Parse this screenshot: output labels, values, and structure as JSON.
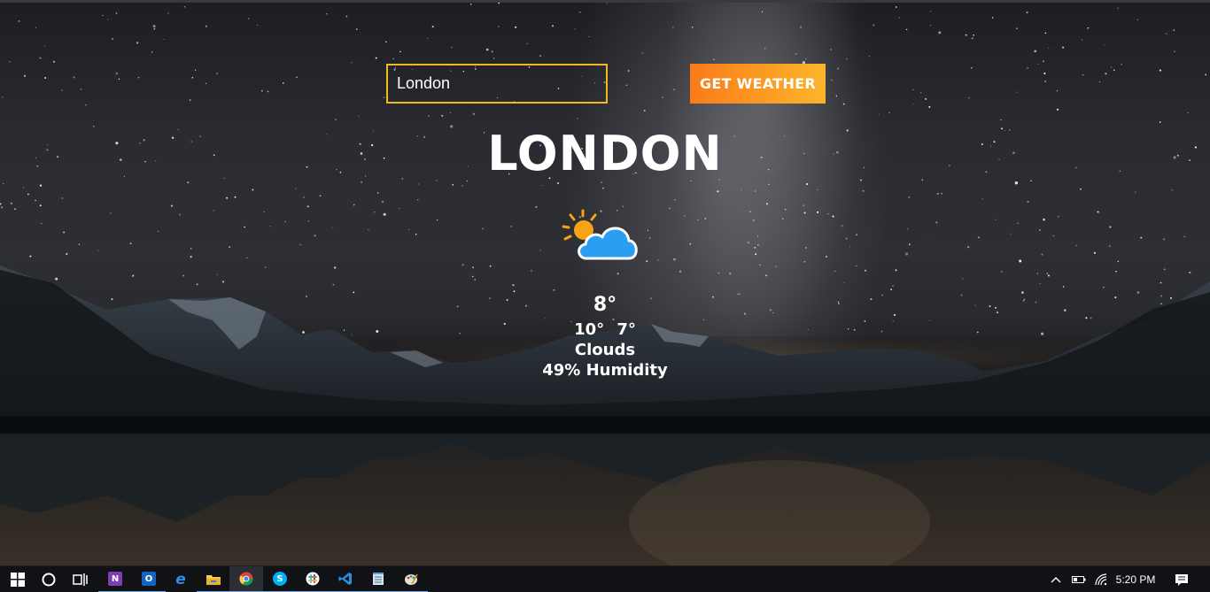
{
  "app": {
    "search": {
      "value": "London",
      "placeholder": ""
    },
    "get_weather_label": "GET WEATHER",
    "city": "LONDON",
    "weather_icon": "sun-behind-cloud-icon",
    "temperature": "8°",
    "temp_max": "10°",
    "temp_min": "7°",
    "description": "Clouds",
    "humidity": "49% Humidity",
    "colors": {
      "input_border": "#f3b71f",
      "button_gradient_start": "#fb7b1a",
      "button_gradient_end": "#fbb52a",
      "text": "#ffffff",
      "sun": "#f6a316",
      "cloud": "#2a9ff2"
    }
  },
  "taskbar": {
    "apps": [
      {
        "name": "start-icon"
      },
      {
        "name": "cortana-icon"
      },
      {
        "name": "task-view-icon"
      },
      {
        "name": "onenote-icon",
        "glyph": "N"
      },
      {
        "name": "outlook-icon",
        "glyph": "O"
      },
      {
        "name": "edge-icon",
        "glyph": "e"
      },
      {
        "name": "file-explorer-icon"
      },
      {
        "name": "chrome-icon"
      },
      {
        "name": "skype-icon",
        "glyph": "S"
      },
      {
        "name": "slack-icon"
      },
      {
        "name": "vscode-icon"
      },
      {
        "name": "notepad-icon"
      },
      {
        "name": "paint-icon"
      }
    ],
    "tray": {
      "icons": [
        "chevron-up-icon",
        "battery-icon",
        "wifi-icon"
      ],
      "time": "5:20 PM",
      "notification_icon": "action-center-icon"
    }
  }
}
